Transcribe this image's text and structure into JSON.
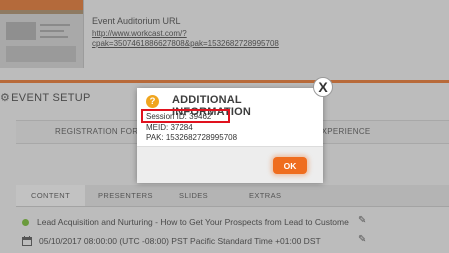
{
  "auditorium": {
    "label": "Event Auditorium URL",
    "url": "http://www.workcast.com/?cpak=3507461886627808&pak=1532682728995708"
  },
  "event_setup": {
    "title": "EVENT SETUP",
    "tabs": [
      "REGISTRATION FORM",
      "EXPERIENCE"
    ]
  },
  "content_tabs": [
    "CONTENT",
    "PRESENTERS",
    "SLIDES",
    "EXTRAS"
  ],
  "session_item": {
    "title": "Lead Acquisition and Nurturing - How to Get Your Prospects from Lead to Custome",
    "datetime": "05/10/2017 08:00:00 (UTC -08:00) PST Pacific Standard Time +01:00 DST"
  },
  "modal": {
    "title": "ADDITIONAL INFORMATION",
    "session_id": "Session ID: 39462",
    "meid": "MEID: 37284",
    "pak": "PAK: 1532682728995708",
    "ok_label": "OK",
    "close_label": "X"
  },
  "colors": {
    "accent": "#ef6d1f",
    "highlight": "#e0121e",
    "info_icon": "#f0a51f",
    "status_dot": "#6a9a3c"
  }
}
